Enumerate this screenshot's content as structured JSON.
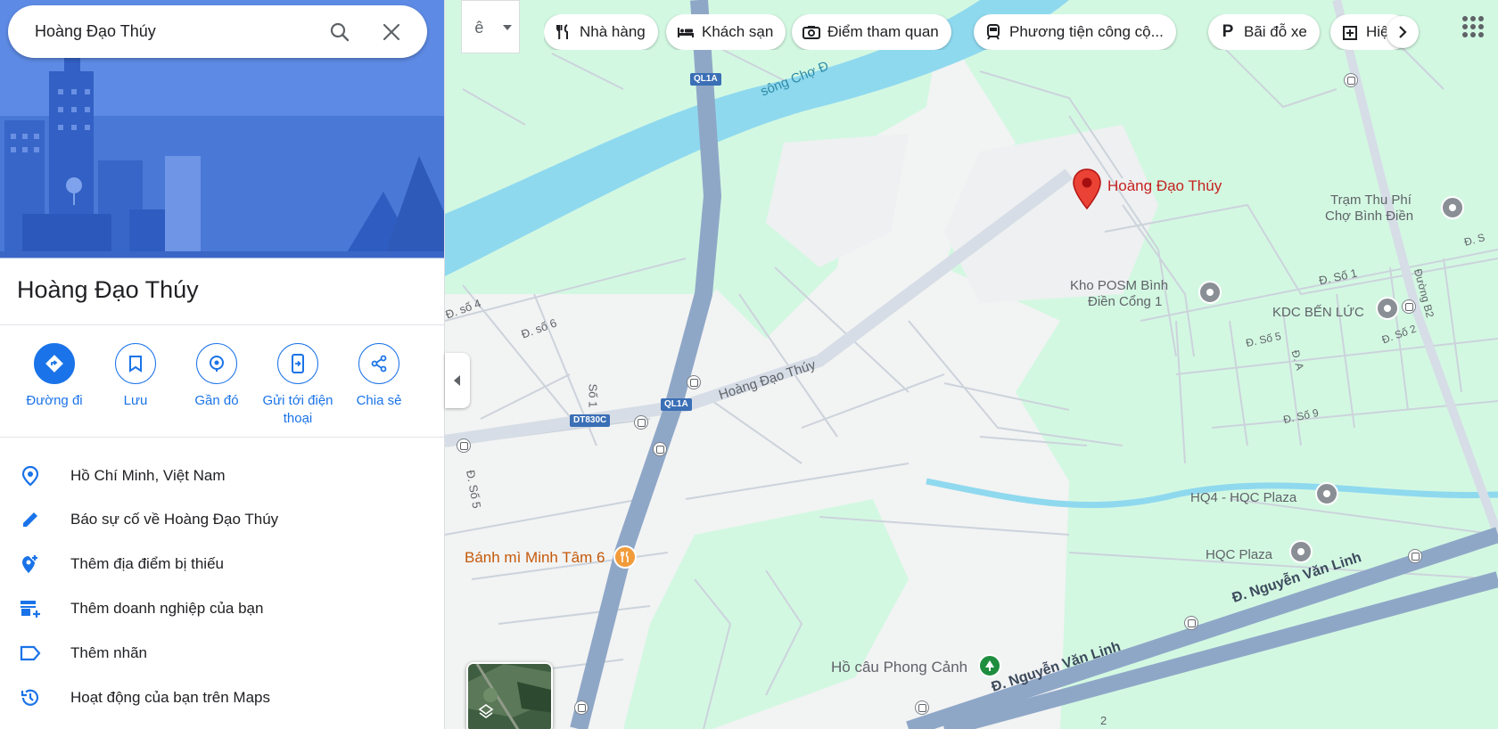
{
  "search": {
    "value": "Hoàng Đạo Thúy"
  },
  "place": {
    "title": "Hoàng Đạo Thúy"
  },
  "actions": [
    {
      "label": "Đường đi"
    },
    {
      "label": "Lưu"
    },
    {
      "label": "Gần đó"
    },
    {
      "label": "Gửi tới điện thoại"
    },
    {
      "label": "Chia sẻ"
    }
  ],
  "info_rows": [
    {
      "text": "Hồ Chí Minh, Việt Nam",
      "icon": "location-pin-icon"
    },
    {
      "text": "Báo sự cố về Hoàng Đạo Thúy",
      "icon": "pencil-icon"
    },
    {
      "text": "Thêm địa điểm bị thiếu",
      "icon": "add-location-icon"
    },
    {
      "text": "Thêm doanh nghiệp của bạn",
      "icon": "add-business-icon"
    },
    {
      "text": "Thêm nhãn",
      "icon": "label-icon"
    },
    {
      "text": "Hoạt động của bạn trên Maps",
      "icon": "history-icon"
    }
  ],
  "ime": {
    "label": "ê"
  },
  "chips": [
    {
      "label": "Nhà hàng",
      "icon": "restaurant-icon"
    },
    {
      "label": "Khách sạn",
      "icon": "hotel-icon"
    },
    {
      "label": "Điểm tham quan",
      "icon": "camera-icon"
    },
    {
      "label": "Phương tiện công cộ...",
      "icon": "transit-icon"
    },
    {
      "label": "Bãi đỗ xe",
      "icon": "parking-icon"
    },
    {
      "label": "Hiệu",
      "icon": "pharmacy-icon"
    }
  ],
  "map": {
    "pin_label": "Hoàng Đạo Thúy",
    "labels": {
      "river": "sông Chợ Đ",
      "road_main": "Hoàng Đạo Thúy",
      "so4": "Đ. số 4",
      "so6": "Đ. số 6",
      "so1": "Số 1",
      "so5_left": "Đ. Số 5",
      "tram_line1": "Trạm Thu Phí",
      "tram_line2": "Chợ Bình Điền",
      "kho_line1": "Kho POSM Bình",
      "kho_line2": "Điền Cổng 1",
      "kdc": "KDC BẾN LỨC",
      "dso1": "Đ. Số 1",
      "dso5": "Đ. Số 5",
      "dso2": "Đ. Số 2",
      "dso9": "Đ. Số 9",
      "da": "Đ. A",
      "duongb2": "Đường B2",
      "ds": "Đ. S",
      "hq4": "HQ4 - HQC Plaza",
      "hqc": "HQC Plaza",
      "banhmi": "Bánh mì Minh Tâm 6",
      "hocau": "Hồ câu Phong Cảnh",
      "nvl1": "Đ. Nguyễn Văn Linh",
      "nvl2": "Đ. Nguyễn Văn Linh",
      "ql1a_top": "QL1A",
      "ql1a_mid": "QL1A",
      "dt830c": "DT830C",
      "num2": "2"
    },
    "colors": {
      "water": "#8fd9ef",
      "green": "#d3f8e2",
      "highway": "#8fa7c7",
      "road": "#d6dde6",
      "pin": "#ea4335",
      "accent": "#1a73e8"
    }
  }
}
